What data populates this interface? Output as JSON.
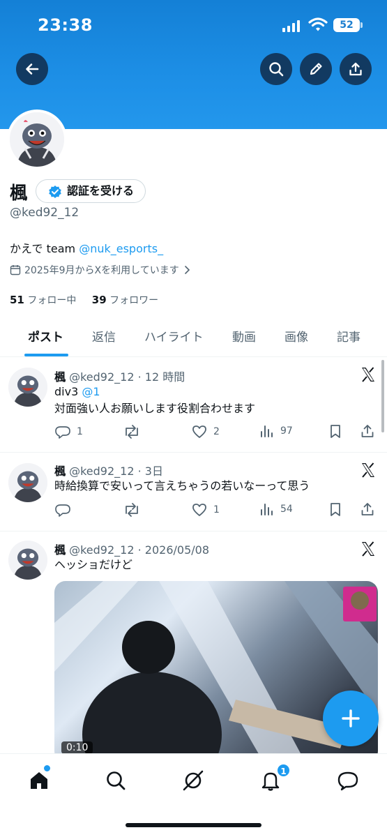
{
  "status_bar": {
    "time": "23:38",
    "battery": "52"
  },
  "profile": {
    "name": "楓",
    "verify_label": "認証を受ける",
    "handle": "@ked92_12",
    "bio_text": "かえで team ",
    "bio_mention": "@nuk_esports_",
    "joined": "2025年9月からXを利用しています",
    "following_count": "51",
    "following_label": "フォロー中",
    "followers_count": "39",
    "followers_label": "フォロワー"
  },
  "tabs": [
    "ポスト",
    "返信",
    "ハイライト",
    "動画",
    "画像",
    "記事"
  ],
  "posts": [
    {
      "name": "楓",
      "meta": "@ked92_12 · 12 時間",
      "line1": "div3 ",
      "line1_mention": "@1",
      "line2": "対面強い人お願いします役割合わせます",
      "replies": "1",
      "reposts": "",
      "likes": "2",
      "views": "97"
    },
    {
      "name": "楓",
      "meta": "@ked92_12 · 3日",
      "line1": "時給換算で安いって言えちゃうの若いなーって思う",
      "replies": "",
      "reposts": "",
      "likes": "1",
      "views": "54"
    },
    {
      "name": "楓",
      "meta": "@ked92_12 · 2026/05/08",
      "line1": "ヘッショだけど",
      "video_duration": "0:10"
    }
  ],
  "nav": {
    "notifications_badge": "1"
  },
  "colors": {
    "accent": "#1d9bf0",
    "banner": "#1d8fe6"
  }
}
